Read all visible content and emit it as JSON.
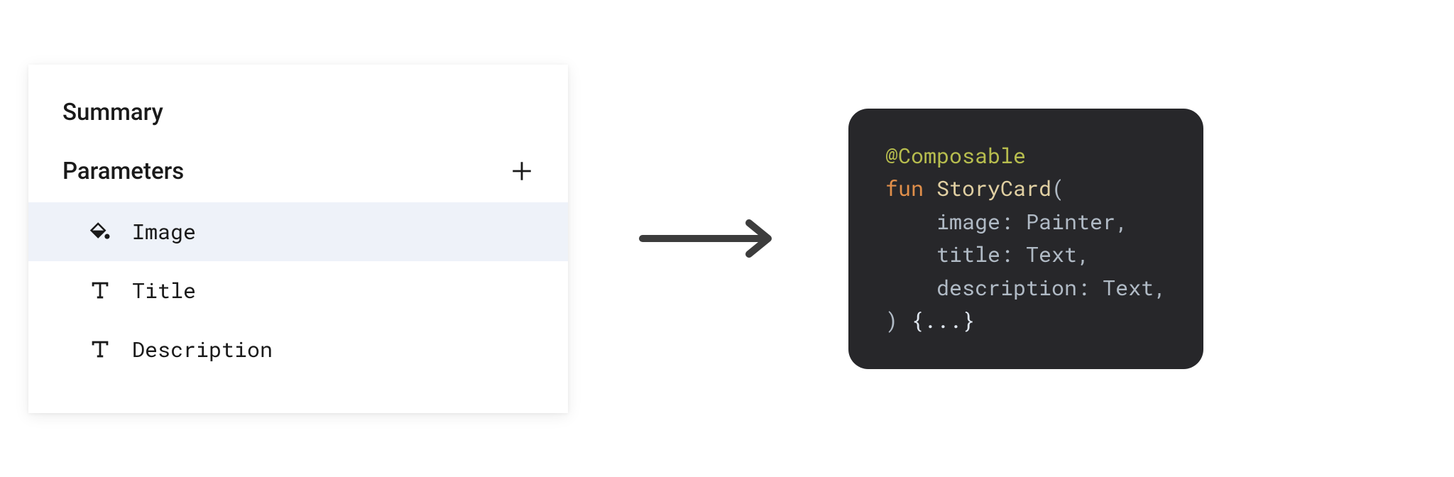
{
  "panel": {
    "summary_title": "Summary",
    "parameters_title": "Parameters",
    "parameters": [
      {
        "label": "Image",
        "icon": "fill",
        "selected": true
      },
      {
        "label": "Title",
        "icon": "text",
        "selected": false
      },
      {
        "label": "Description",
        "icon": "text",
        "selected": false
      }
    ]
  },
  "code": {
    "annotation": "@Composable",
    "keyword_fun": "fun",
    "func_name": "StoryCard",
    "open_paren": "(",
    "params": [
      {
        "name": "image",
        "type": "Painter"
      },
      {
        "name": "title",
        "type": "Text"
      },
      {
        "name": "description",
        "type": "Text"
      }
    ],
    "close_paren": ")",
    "body": "{...}"
  }
}
